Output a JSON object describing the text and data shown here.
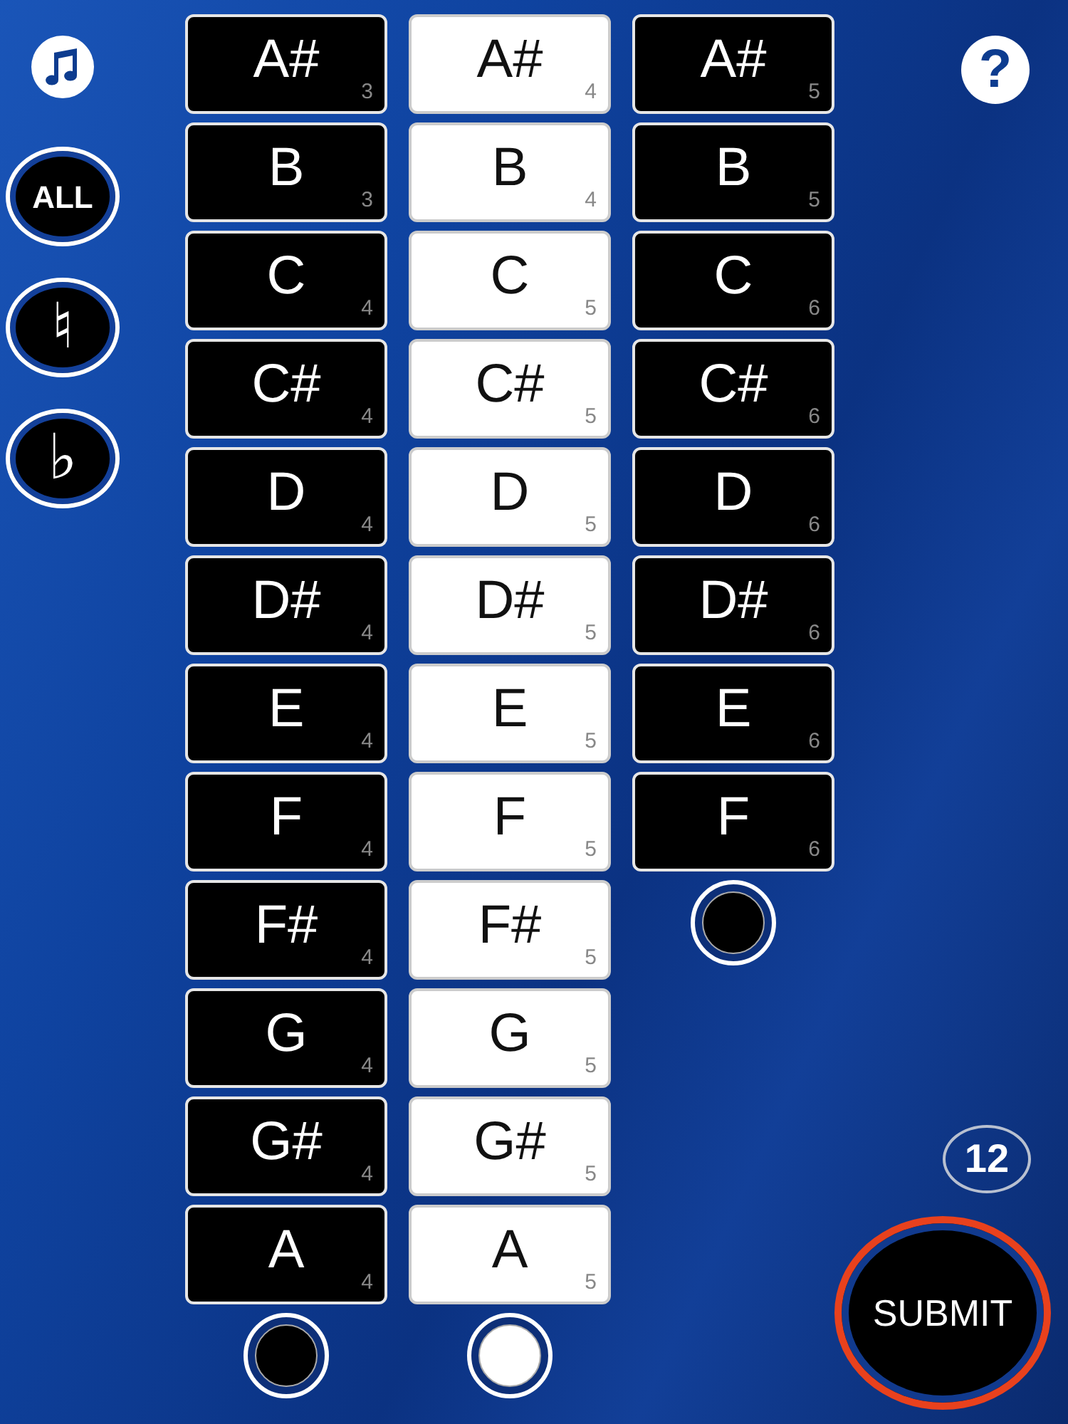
{
  "sidebar": {
    "all_button": {
      "label": "ALL"
    },
    "natural_button": {
      "label": "♮"
    },
    "flat_button": {
      "label": "♭"
    }
  },
  "help_button": {
    "label": "?"
  },
  "columns": [
    {
      "selected": false,
      "notes": [
        {
          "name": "A#",
          "octave": "3"
        },
        {
          "name": "B",
          "octave": "3"
        },
        {
          "name": "C",
          "octave": "4"
        },
        {
          "name": "C#",
          "octave": "4"
        },
        {
          "name": "D",
          "octave": "4"
        },
        {
          "name": "D#",
          "octave": "4"
        },
        {
          "name": "E",
          "octave": "4"
        },
        {
          "name": "F",
          "octave": "4"
        },
        {
          "name": "F#",
          "octave": "4"
        },
        {
          "name": "G",
          "octave": "4"
        },
        {
          "name": "G#",
          "octave": "4"
        },
        {
          "name": "A",
          "octave": "4"
        }
      ]
    },
    {
      "selected": true,
      "notes": [
        {
          "name": "A#",
          "octave": "4"
        },
        {
          "name": "B",
          "octave": "4"
        },
        {
          "name": "C",
          "octave": "5"
        },
        {
          "name": "C#",
          "octave": "5"
        },
        {
          "name": "D",
          "octave": "5"
        },
        {
          "name": "D#",
          "octave": "5"
        },
        {
          "name": "E",
          "octave": "5"
        },
        {
          "name": "F",
          "octave": "5"
        },
        {
          "name": "F#",
          "octave": "5"
        },
        {
          "name": "G",
          "octave": "5"
        },
        {
          "name": "G#",
          "octave": "5"
        },
        {
          "name": "A",
          "octave": "5"
        }
      ]
    },
    {
      "selected": false,
      "notes": [
        {
          "name": "A#",
          "octave": "5"
        },
        {
          "name": "B",
          "octave": "5"
        },
        {
          "name": "C",
          "octave": "6"
        },
        {
          "name": "C#",
          "octave": "6"
        },
        {
          "name": "D",
          "octave": "6"
        },
        {
          "name": "D#",
          "octave": "6"
        },
        {
          "name": "E",
          "octave": "6"
        },
        {
          "name": "F",
          "octave": "6"
        }
      ]
    }
  ],
  "count": "12",
  "submit_button": {
    "label": "SUBMIT"
  }
}
